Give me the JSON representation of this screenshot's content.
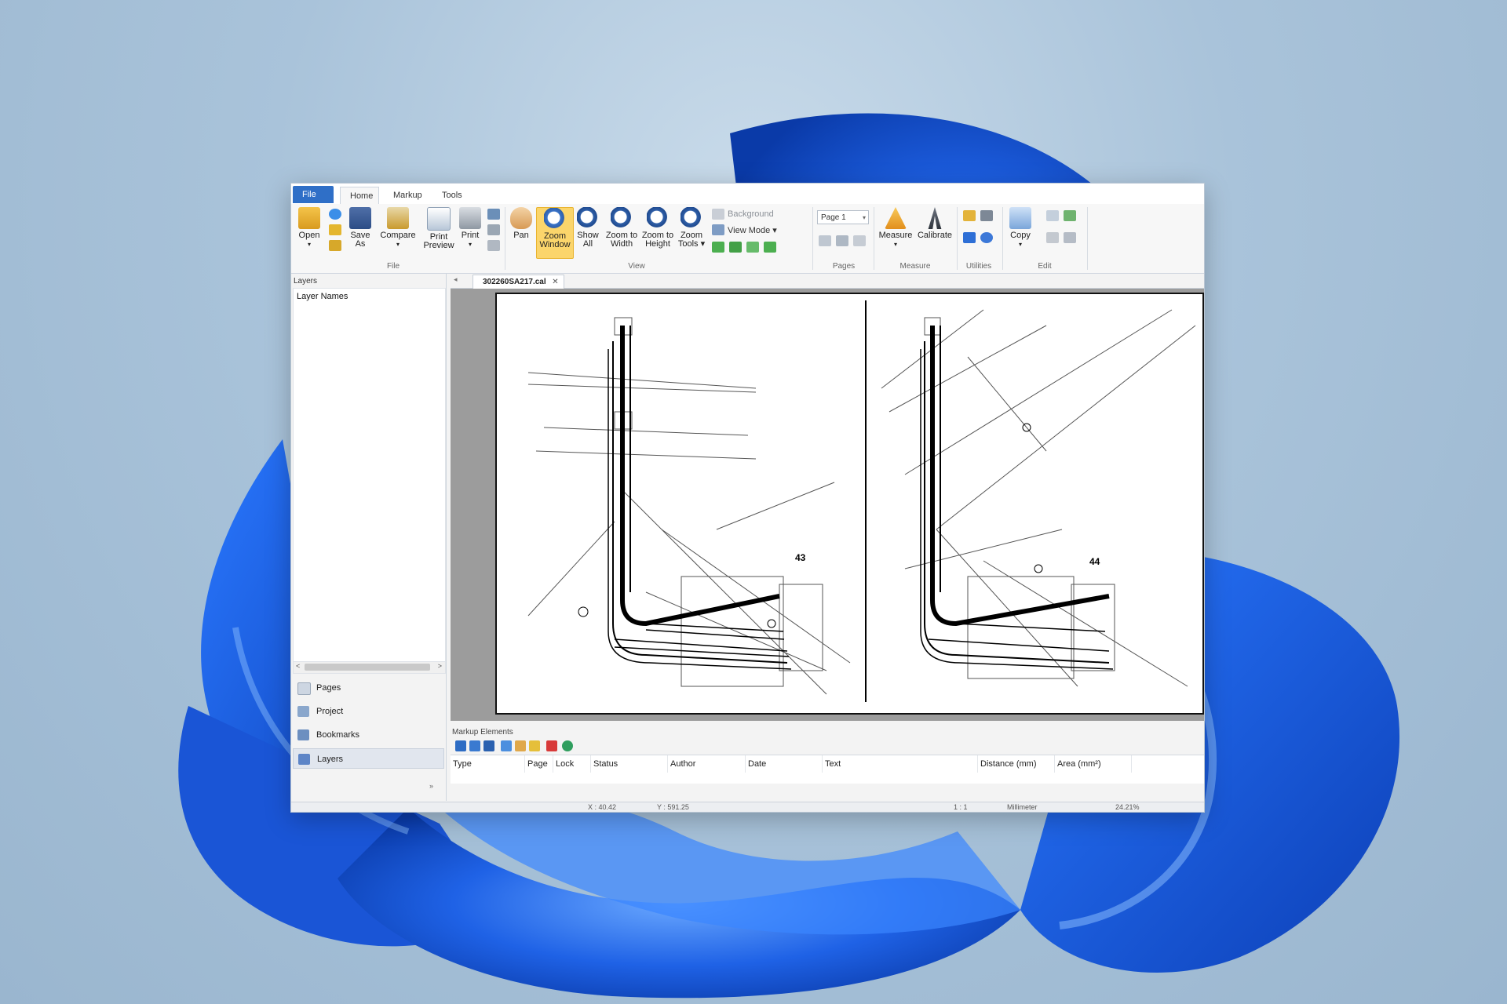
{
  "colors": {
    "accent": "#2f6fc7",
    "highlight": "#fbd56b",
    "wallpaper_blue": "#1e5fe0"
  },
  "tabs": {
    "file": "File",
    "home": "Home",
    "markup": "Markup",
    "tools": "Tools"
  },
  "ribbon": {
    "file_group": {
      "label": "File",
      "open": "Open",
      "save_as_1": "Save",
      "save_as_2": "As",
      "compare": "Compare",
      "print_preview_1": "Print",
      "print_preview_2": "Preview",
      "print": "Print"
    },
    "view_group": {
      "label": "View",
      "pan": "Pan",
      "zoom_window_1": "Zoom",
      "zoom_window_2": "Window",
      "show_all_1": "Show",
      "show_all_2": "All",
      "zoom_width_1": "Zoom to",
      "zoom_width_2": "Width",
      "zoom_height_1": "Zoom to",
      "zoom_height_2": "Height",
      "zoom_tools_1": "Zoom",
      "zoom_tools_2": "Tools",
      "background": "Background",
      "view_mode": "View Mode"
    },
    "pages_group": {
      "label": "Pages",
      "page_select": "Page 1"
    },
    "measure_group": {
      "label": "Measure",
      "measure": "Measure",
      "calibrate": "Calibrate"
    },
    "utilities_group": {
      "label": "Utilities"
    },
    "edit_group": {
      "label": "Edit",
      "copy": "Copy"
    }
  },
  "left_panel": {
    "title": "Layers",
    "tree_header": "Layer Names",
    "nav": [
      {
        "label": "Pages",
        "icon": "pages-icon"
      },
      {
        "label": "Project",
        "icon": "project-icon"
      },
      {
        "label": "Bookmarks",
        "icon": "bookmarks-icon"
      },
      {
        "label": "Layers",
        "icon": "layers-icon"
      }
    ]
  },
  "document": {
    "tab_name": "302260SA217.cal",
    "sheet_left": "43",
    "sheet_right": "44"
  },
  "markup_panel": {
    "title": "Markup Elements",
    "columns": [
      "Type",
      "Page",
      "Lock",
      "Status",
      "Author",
      "Date",
      "Text",
      "Distance (mm)",
      "Area (mm²)"
    ]
  },
  "status": {
    "x": "X : 40.42",
    "y": "Y : 591.25",
    "scale": "1 : 1",
    "units": "Millimeter",
    "zoom": "24.21%"
  }
}
